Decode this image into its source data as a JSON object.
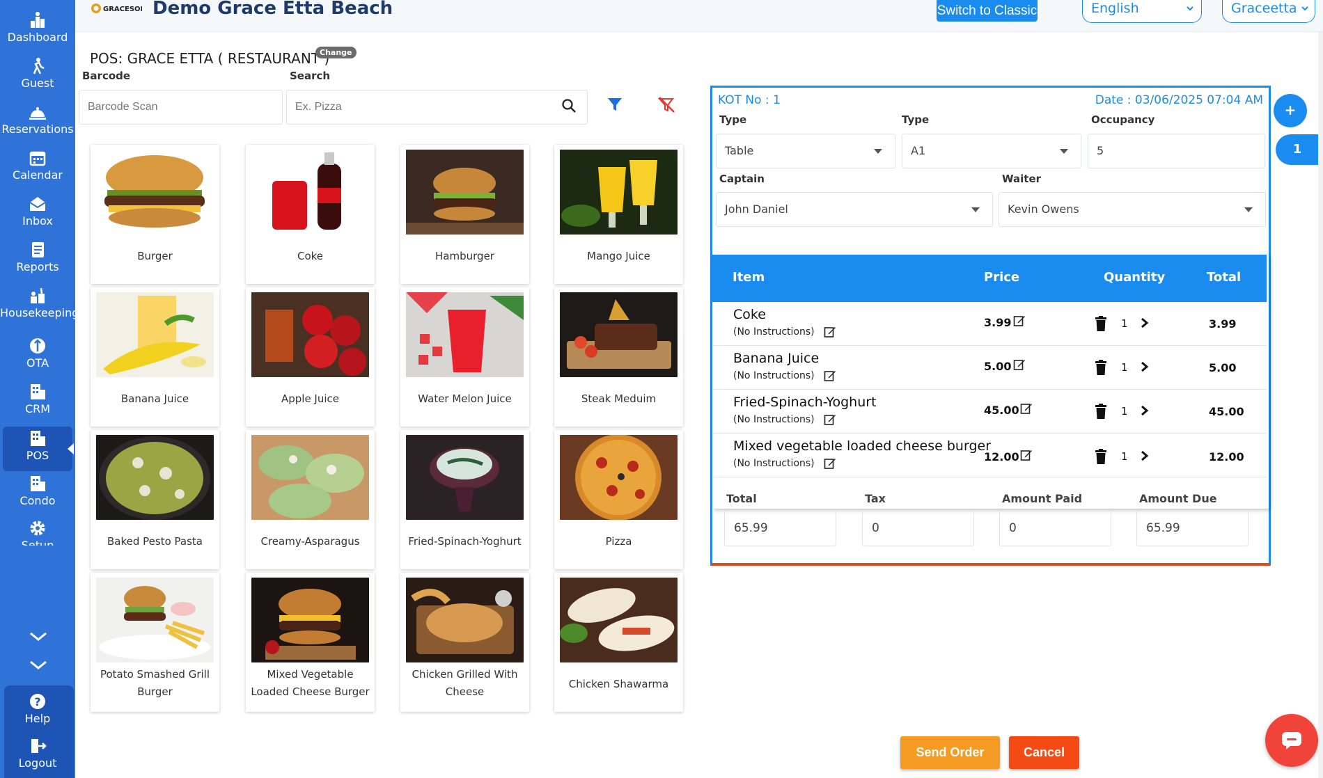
{
  "sidebar": {
    "items": [
      {
        "label": "Dashboard",
        "icon": "dashboard-icon"
      },
      {
        "label": "Guest",
        "icon": "guest-icon"
      },
      {
        "label": "Reservations",
        "icon": "reservations-icon"
      },
      {
        "label": "Calendar",
        "icon": "calendar-icon"
      },
      {
        "label": "Inbox",
        "icon": "inbox-icon"
      },
      {
        "label": "Reports",
        "icon": "reports-icon"
      },
      {
        "label": "Housekeeping",
        "icon": "housekeeping-icon"
      },
      {
        "label": "OTA",
        "icon": "ota-icon"
      },
      {
        "label": "CRM",
        "icon": "crm-icon"
      },
      {
        "label": "POS",
        "icon": "pos-icon",
        "active": true
      },
      {
        "label": "Condo",
        "icon": "condo-icon"
      },
      {
        "label": "Setup",
        "icon": "setup-icon"
      }
    ],
    "bottom": [
      {
        "label": "Help",
        "icon": "help-icon"
      },
      {
        "label": "Logout",
        "icon": "logout-icon"
      }
    ]
  },
  "header": {
    "logo_text": "GRACESOFT",
    "title": "Demo Grace Etta Beach",
    "switch_label": "Switch to Classic",
    "language": "English",
    "user": "Graceetta"
  },
  "pos": {
    "title": "POS: GRACE ETTA ( RESTAURANT )",
    "change_label": "Change",
    "barcode_label": "Barcode",
    "barcode_placeholder": "Barcode Scan",
    "search_label": "Search",
    "search_placeholder": "Ex. Pizza"
  },
  "products": [
    {
      "name": "Burger"
    },
    {
      "name": "Coke"
    },
    {
      "name": "Hamburger"
    },
    {
      "name": "Mango Juice"
    },
    {
      "name": "Banana Juice"
    },
    {
      "name": "Apple Juice"
    },
    {
      "name": "Water Melon Juice"
    },
    {
      "name": "Steak Meduim"
    },
    {
      "name": "Baked Pesto Pasta"
    },
    {
      "name": "Creamy-Asparagus"
    },
    {
      "name": "Fried-Spinach-Yoghurt"
    },
    {
      "name": "Pizza"
    },
    {
      "name": "Potato Smashed Grill Burger"
    },
    {
      "name": "Mixed Vegetable Loaded Cheese Burger"
    },
    {
      "name": "Chicken Grilled With Cheese"
    },
    {
      "name": "Chicken Shawarma"
    }
  ],
  "kot": {
    "no_label": "KOT No : 1",
    "date_label": "Date : 03/06/2025 07:04 AM",
    "type1_label": "Type",
    "type1_value": "Table",
    "type2_label": "Type",
    "type2_value": "A1",
    "occupancy_label": "Occupancy",
    "occupancy_value": "5",
    "captain_label": "Captain",
    "captain_value": "John Daniel",
    "waiter_label": "Waiter",
    "waiter_value": "Kevin Owens",
    "columns": {
      "item": "Item",
      "price": "Price",
      "quantity": "Quantity",
      "total": "Total"
    },
    "items": [
      {
        "name": "Coke",
        "instructions": "(No Instructions)",
        "price": "3.99",
        "qty": "1",
        "total": "3.99"
      },
      {
        "name": "Banana Juice",
        "instructions": "(No Instructions)",
        "price": "5.00",
        "qty": "1",
        "total": "5.00"
      },
      {
        "name": "Fried-Spinach-Yoghurt",
        "instructions": "(No Instructions)",
        "price": "45.00",
        "qty": "1",
        "total": "45.00"
      },
      {
        "name": "Mixed vegetable loaded cheese burger",
        "instructions": "(No Instructions)",
        "price": "12.00",
        "qty": "1",
        "total": "12.00"
      }
    ],
    "summary": {
      "total_label": "Total",
      "total_value": "65.99",
      "tax_label": "Tax",
      "tax_value": "0",
      "paid_label": "Amount Paid",
      "paid_value": "0",
      "due_label": "Amount Due",
      "due_value": "65.99"
    }
  },
  "side_tabs": {
    "add": "+",
    "count": "1"
  },
  "actions": {
    "send": "Send Order",
    "cancel": "Cancel"
  },
  "colors": {
    "primary": "#1a8cf0",
    "sidebar": "#2f73d8",
    "send": "#f59b23",
    "cancel": "#f44b14"
  }
}
